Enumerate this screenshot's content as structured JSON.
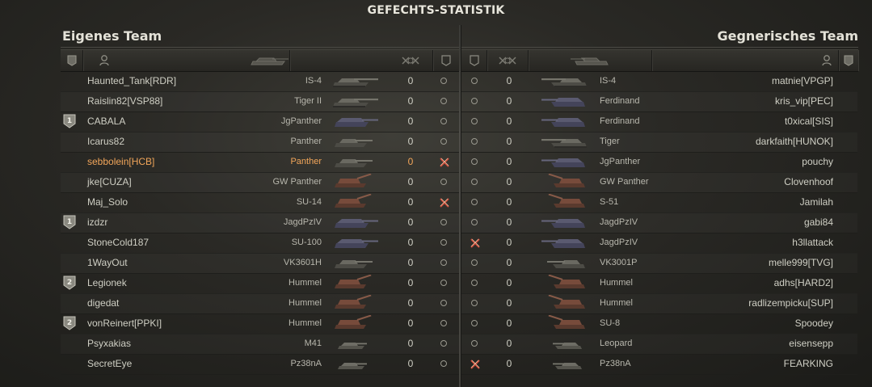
{
  "title": "GEFECHTS-STATISTIK",
  "teams": {
    "left_label": "Eigenes Team",
    "right_label": "Gegnerisches Team"
  },
  "colors": {
    "highlight": "#f2a65a",
    "text": "#cfcfc4",
    "cross": "#d04a3a"
  },
  "left_rows": [
    {
      "rank": "",
      "player": "Haunted_Tank[RDR]",
      "tank": "IS-4",
      "tank_icon": "heavy-tank-icon",
      "frags": "0",
      "status": "alive",
      "highlight": false
    },
    {
      "rank": "",
      "player": "Raislin82[VSP88]",
      "tank": "Tiger II",
      "tank_icon": "heavy-tank-icon",
      "frags": "0",
      "status": "alive",
      "highlight": false
    },
    {
      "rank": "1",
      "player": "CABALA",
      "tank": "JgPanther",
      "tank_icon": "td-icon",
      "frags": "0",
      "status": "alive",
      "highlight": false
    },
    {
      "rank": "",
      "player": "Icarus82",
      "tank": "Panther",
      "tank_icon": "medium-tank-icon",
      "frags": "0",
      "status": "alive",
      "highlight": false
    },
    {
      "rank": "",
      "player": "sebbolein[HCB]",
      "tank": "Panther",
      "tank_icon": "medium-tank-icon",
      "frags": "0",
      "status": "destroyed",
      "highlight": true
    },
    {
      "rank": "",
      "player": "jke[CUZA]",
      "tank": "GW Panther",
      "tank_icon": "spg-icon",
      "frags": "0",
      "status": "alive",
      "highlight": false
    },
    {
      "rank": "",
      "player": "Maj_Solo",
      "tank": "SU-14",
      "tank_icon": "spg-icon",
      "frags": "0",
      "status": "destroyed",
      "highlight": false
    },
    {
      "rank": "1",
      "player": "izdzr",
      "tank": "JagdPzIV",
      "tank_icon": "td-icon",
      "frags": "0",
      "status": "alive",
      "highlight": false
    },
    {
      "rank": "",
      "player": "StoneCold187",
      "tank": "SU-100",
      "tank_icon": "td-icon",
      "frags": "0",
      "status": "alive",
      "highlight": false
    },
    {
      "rank": "",
      "player": "1WayOut",
      "tank": "VK3601H",
      "tank_icon": "medium-tank-icon",
      "frags": "0",
      "status": "alive",
      "highlight": false
    },
    {
      "rank": "2",
      "player": "Legionek",
      "tank": "Hummel",
      "tank_icon": "spg-icon",
      "frags": "0",
      "status": "alive",
      "highlight": false
    },
    {
      "rank": "",
      "player": "digedat",
      "tank": "Hummel",
      "tank_icon": "spg-icon",
      "frags": "0",
      "status": "alive",
      "highlight": false
    },
    {
      "rank": "2",
      "player": "vonReinert[PPKI]",
      "tank": "Hummel",
      "tank_icon": "spg-icon",
      "frags": "0",
      "status": "alive",
      "highlight": false
    },
    {
      "rank": "",
      "player": "Psyxakias",
      "tank": "M41",
      "tank_icon": "light-tank-icon",
      "frags": "0",
      "status": "alive",
      "highlight": false
    },
    {
      "rank": "",
      "player": "SecretEye",
      "tank": "Pz38nA",
      "tank_icon": "light-tank-icon",
      "frags": "0",
      "status": "alive",
      "highlight": false
    }
  ],
  "right_rows": [
    {
      "status": "alive",
      "frags": "0",
      "tank": "IS-4",
      "tank_icon": "heavy-tank-icon",
      "player": "matnie[VPGP]"
    },
    {
      "status": "alive",
      "frags": "0",
      "tank": "Ferdinand",
      "tank_icon": "td-icon",
      "player": "kris_vip[PEC]"
    },
    {
      "status": "alive",
      "frags": "0",
      "tank": "Ferdinand",
      "tank_icon": "td-icon",
      "player": "t0xical[SIS]"
    },
    {
      "status": "alive",
      "frags": "0",
      "tank": "Tiger",
      "tank_icon": "heavy-tank-icon",
      "player": "darkfaith[HUNOK]"
    },
    {
      "status": "alive",
      "frags": "0",
      "tank": "JgPanther",
      "tank_icon": "td-icon",
      "player": "pouchy"
    },
    {
      "status": "alive",
      "frags": "0",
      "tank": "GW Panther",
      "tank_icon": "spg-icon",
      "player": "Clovenhoof"
    },
    {
      "status": "alive",
      "frags": "0",
      "tank": "S-51",
      "tank_icon": "spg-icon",
      "player": "Jamilah"
    },
    {
      "status": "alive",
      "frags": "0",
      "tank": "JagdPzIV",
      "tank_icon": "td-icon",
      "player": "gabi84"
    },
    {
      "status": "destroyed",
      "frags": "0",
      "tank": "JagdPzIV",
      "tank_icon": "td-icon",
      "player": "h3llattack"
    },
    {
      "status": "alive",
      "frags": "0",
      "tank": "VK3001P",
      "tank_icon": "medium-tank-icon",
      "player": "melle999[TVG]"
    },
    {
      "status": "alive",
      "frags": "0",
      "tank": "Hummel",
      "tank_icon": "spg-icon",
      "player": "adhs[HARD2]"
    },
    {
      "status": "alive",
      "frags": "0",
      "tank": "Hummel",
      "tank_icon": "spg-icon",
      "player": "radlizempicku[SUP]"
    },
    {
      "status": "alive",
      "frags": "0",
      "tank": "SU-8",
      "tank_icon": "spg-icon",
      "player": "Spoodey"
    },
    {
      "status": "alive",
      "frags": "0",
      "tank": "Leopard",
      "tank_icon": "light-tank-icon",
      "player": "eisensepp"
    },
    {
      "status": "destroyed",
      "frags": "0",
      "tank": "Pz38nA",
      "tank_icon": "light-tank-icon",
      "player": "FEARKING"
    }
  ]
}
